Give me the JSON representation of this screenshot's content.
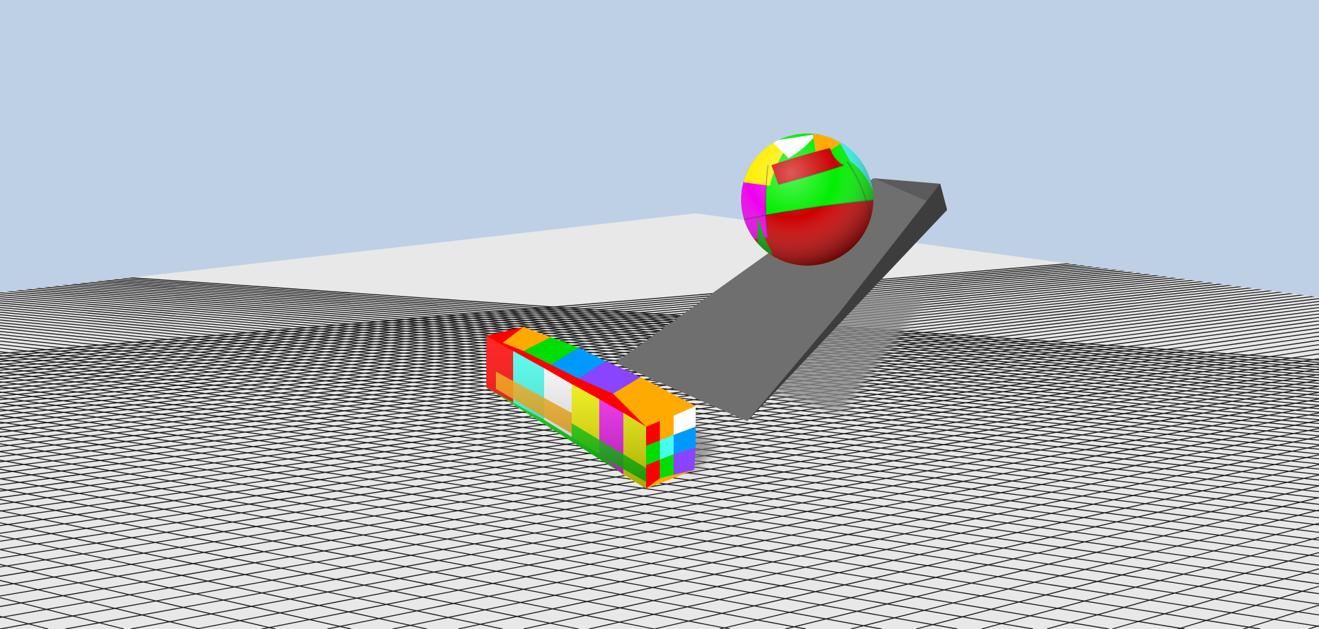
{
  "scene": {
    "sky_color": "#bed0e6",
    "floor_color": "#e8e8e8",
    "grid_line_color": "#1c1c1c",
    "objects": [
      {
        "name": "checkered-floor",
        "kind": "grid-plane"
      },
      {
        "name": "gray-ramp",
        "kind": "wedge",
        "color": "#6f6f6f"
      },
      {
        "name": "striped-ball",
        "kind": "sphere",
        "colors": [
          "#00ee00",
          "#cc0000",
          "#ee00ee",
          "#ffee00",
          "#ffffff",
          "#ffaa00",
          "#33eeee"
        ]
      },
      {
        "name": "colorful-box",
        "kind": "box",
        "colors": [
          "#ff0000",
          "#00dd00",
          "#ffaa00",
          "#44ffee",
          "#0099ff",
          "#ffffff",
          "#8844ff",
          "#ffff00",
          "#ff22ff"
        ]
      }
    ]
  }
}
